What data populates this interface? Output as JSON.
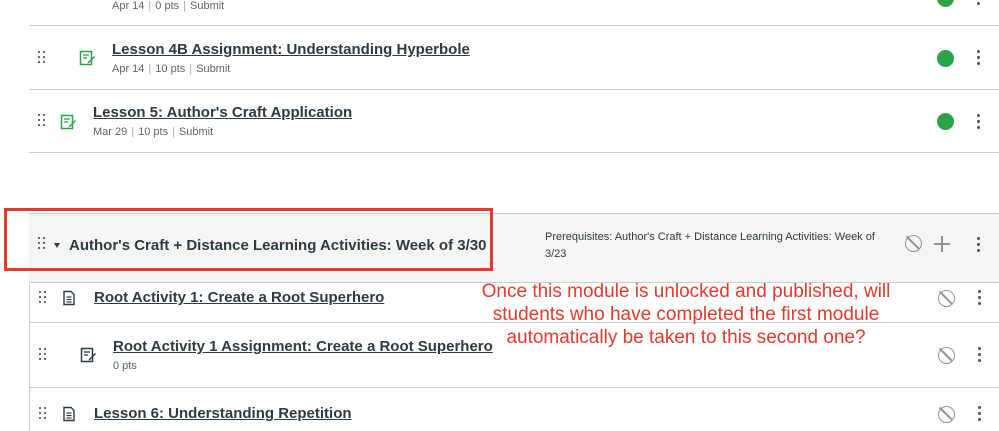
{
  "module1": {
    "items": [
      {
        "title": "",
        "meta": [
          "Apr 14",
          "0 pts",
          "Submit"
        ],
        "icon": "assignment-icon",
        "indent": true,
        "completed": true
      },
      {
        "title": "Lesson 4B Assignment: Understanding Hyperbole",
        "meta": [
          "Apr 14",
          "10 pts",
          "Submit"
        ],
        "icon": "assignment-icon",
        "indent": true,
        "completed": true
      },
      {
        "title": "Lesson 5: Author's Craft Application",
        "meta": [
          "Mar 29",
          "10 pts",
          "Submit"
        ],
        "icon": "assignment-icon",
        "indent": false,
        "completed": true
      }
    ]
  },
  "module2": {
    "title": "Author's Craft + Distance Learning Activities: Week of 3/30",
    "prerequisites": "Prerequisites: Author's Craft + Distance Learning Activities: Week of 3/23",
    "items": [
      {
        "title": "Root Activity 1: Create a Root Superhero",
        "meta": [],
        "icon": "page-icon",
        "indent": false
      },
      {
        "title": "Root Activity 1 Assignment: Create a Root Superhero",
        "meta": [
          "0 pts"
        ],
        "icon": "assignment-icon",
        "indent": true
      },
      {
        "title": "Lesson 6: Understanding Repetition",
        "meta": [],
        "icon": "page-icon",
        "indent": false
      }
    ]
  },
  "annotation": {
    "text": "Once this module is unlocked and published, will students who have completed the first module automatically be taken to this second one?"
  },
  "colors": {
    "accent_green": "#3aa536",
    "check_green": "#2aa34a",
    "annotation_red": "#e23a2d"
  }
}
